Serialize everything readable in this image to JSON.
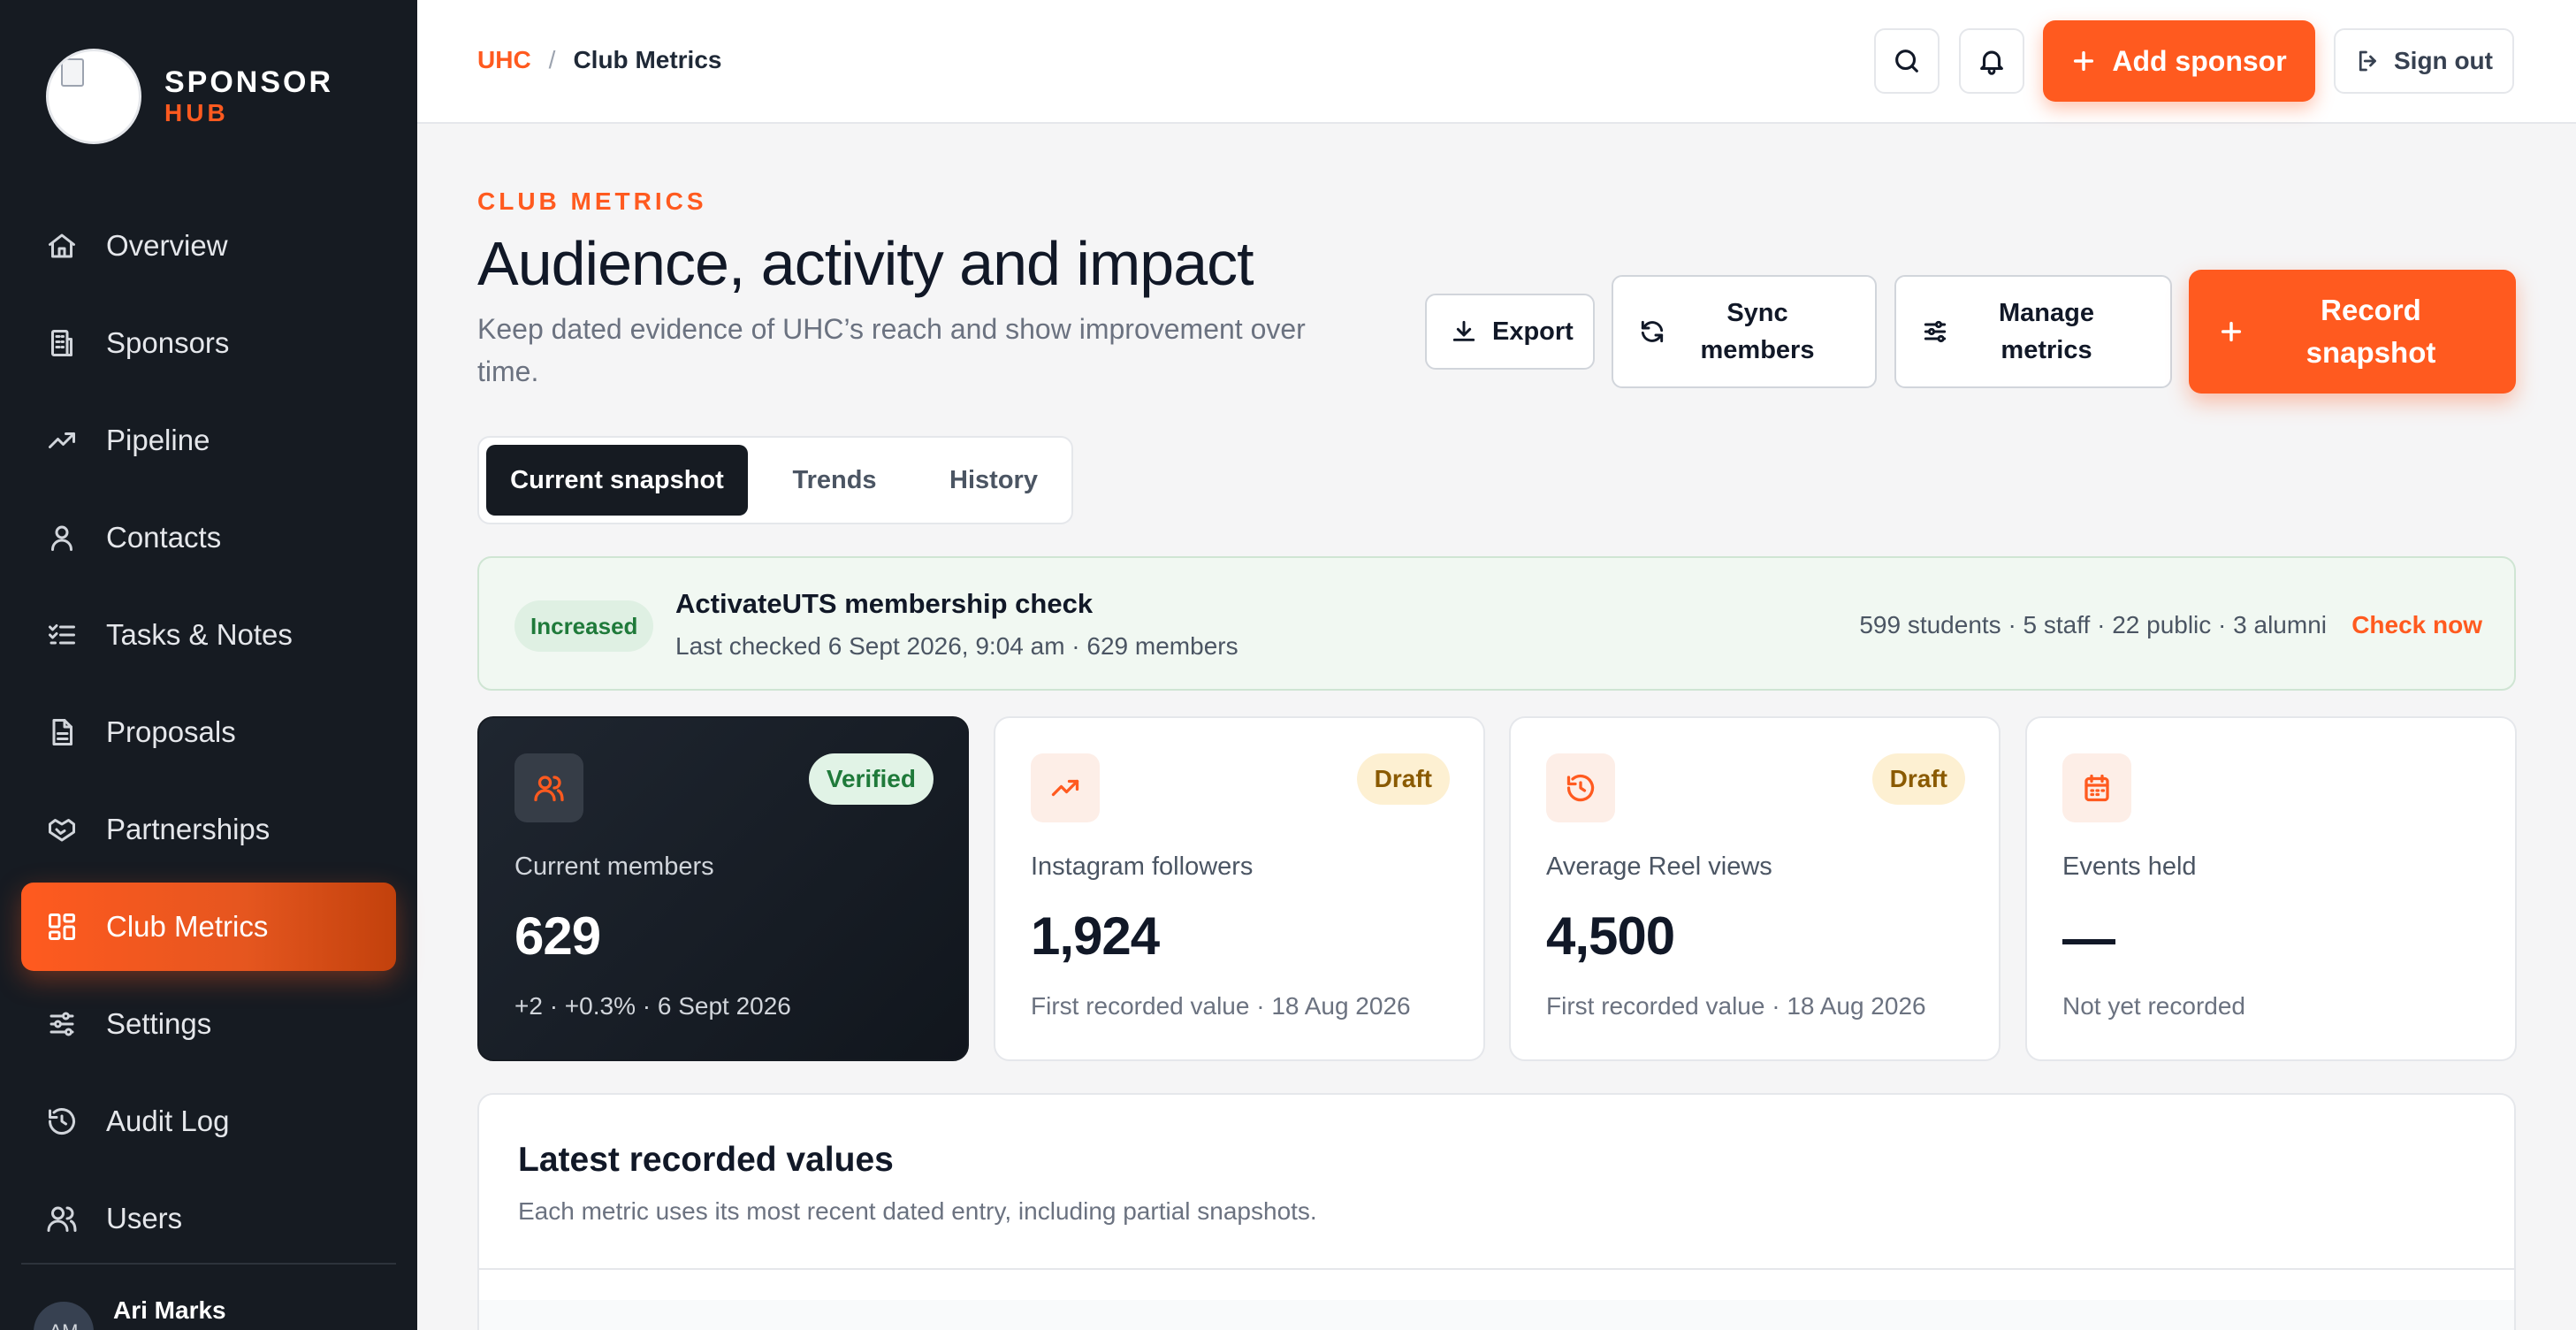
{
  "brand": {
    "line1": "SPONSOR",
    "line2": "HUB"
  },
  "nav": [
    {
      "label": "Overview",
      "icon": "home-icon"
    },
    {
      "label": "Sponsors",
      "icon": "building-icon"
    },
    {
      "label": "Pipeline",
      "icon": "trend-up-icon"
    },
    {
      "label": "Contacts",
      "icon": "user-icon"
    },
    {
      "label": "Tasks & Notes",
      "icon": "checklist-icon"
    },
    {
      "label": "Proposals",
      "icon": "document-icon"
    },
    {
      "label": "Partnerships",
      "icon": "handshake-icon"
    },
    {
      "label": "Club Metrics",
      "icon": "dashboard-icon",
      "active": true
    },
    {
      "label": "Settings",
      "icon": "sliders-icon"
    },
    {
      "label": "Audit Log",
      "icon": "history-icon"
    },
    {
      "label": "Users",
      "icon": "users-icon"
    }
  ],
  "user": {
    "initials": "AM",
    "name": "Ari Marks"
  },
  "topbar": {
    "breadcrumb_root": "UHC",
    "breadcrumb_sep": "/",
    "breadcrumb_current": "Club Metrics",
    "add_sponsor": "Add sponsor",
    "sign_out": "Sign out"
  },
  "header": {
    "eyebrow": "CLUB METRICS",
    "title": "Audience, activity and impact",
    "description": "Keep dated evidence of UHC’s reach and show improvement over time.",
    "export": "Export",
    "sync_line1": "Sync",
    "sync_line2": "members",
    "manage_line1": "Manage",
    "manage_line2": "metrics",
    "record_line1": "Record",
    "record_line2": "snapshot"
  },
  "tabs": [
    {
      "label": "Current snapshot",
      "active": true
    },
    {
      "label": "Trends"
    },
    {
      "label": "History"
    }
  ],
  "banner": {
    "badge": "Increased",
    "title": "ActivateUTS membership check",
    "subtitle": "Last checked 6 Sept 2026, 9:04 am · 629 members",
    "stats": "599 students · 5 staff · 22 public · 3 alumni",
    "action": "Check now"
  },
  "cards": [
    {
      "label": "Current members",
      "value": "629",
      "badge": "Verified",
      "foot": "+2 · +0.3% · 6 Sept 2026",
      "icon": "users-icon"
    },
    {
      "label": "Instagram followers",
      "value": "1,924",
      "badge": "Draft",
      "foot": "First recorded value · 18 Aug 2026",
      "icon": "trend-up-icon"
    },
    {
      "label": "Average Reel views",
      "value": "4,500",
      "badge": "Draft",
      "foot": "First recorded value · 18 Aug 2026",
      "icon": "history-icon"
    },
    {
      "label": "Events held",
      "value": "",
      "badge": "",
      "foot": "Not yet recorded",
      "icon": "calendar-icon"
    }
  ],
  "latest": {
    "title": "Latest recorded values",
    "subtitle": "Each metric uses its most recent dated entry, including partial snapshots."
  },
  "colors": {
    "accent": "#ff5a1f",
    "sidebar": "#161b22",
    "success": "#1f7a3a",
    "draft": "#8a5a00"
  }
}
